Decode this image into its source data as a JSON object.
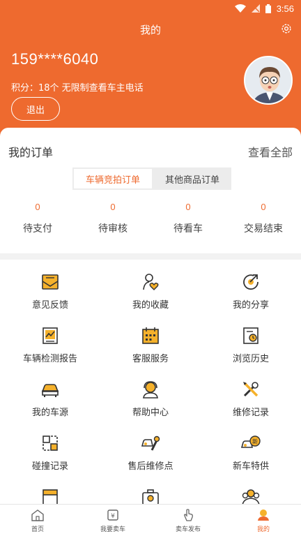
{
  "status": {
    "time": "3:56"
  },
  "header": {
    "title": "我的",
    "phone": "159****6040",
    "points": "积分：18个 无限制查看车主电话",
    "logout_label": "退出"
  },
  "orders": {
    "title": "我的订单",
    "view_all": "查看全部",
    "tabs": [
      {
        "label": "车辆竞拍订单",
        "active": true
      },
      {
        "label": "其他商品订单",
        "active": false
      }
    ],
    "counts": [
      {
        "value": "0",
        "label": "待支付"
      },
      {
        "value": "0",
        "label": "待审核"
      },
      {
        "value": "0",
        "label": "待看车"
      },
      {
        "value": "0",
        "label": "交易结束"
      }
    ]
  },
  "menu": [
    {
      "label": "意见反馈",
      "icon": "feedback-icon"
    },
    {
      "label": "我的收藏",
      "icon": "favorite-icon"
    },
    {
      "label": "我的分享",
      "icon": "share-icon"
    },
    {
      "label": "车辆检测报告",
      "icon": "report-icon"
    },
    {
      "label": "客服服务",
      "icon": "calendar-icon"
    },
    {
      "label": "浏览历史",
      "icon": "history-icon"
    },
    {
      "label": "我的车源",
      "icon": "car-icon"
    },
    {
      "label": "帮助中心",
      "icon": "headset-icon"
    },
    {
      "label": "维修记录",
      "icon": "tools-icon"
    },
    {
      "label": "碰撞记录",
      "icon": "collision-icon"
    },
    {
      "label": "售后维修点",
      "icon": "repair-car-icon"
    },
    {
      "label": "新车特供",
      "icon": "new-car-icon"
    },
    {
      "label": "",
      "icon": "shop-icon"
    },
    {
      "label": "",
      "icon": "camera-icon"
    },
    {
      "label": "",
      "icon": "group-icon"
    }
  ],
  "tabbar": [
    {
      "label": "首页",
      "icon": "home-icon"
    },
    {
      "label": "我要卖车",
      "icon": "sell-car-icon"
    },
    {
      "label": "卖车发布",
      "icon": "publish-icon"
    },
    {
      "label": "我的",
      "icon": "profile-icon",
      "active": true
    }
  ],
  "colors": {
    "accent": "#ee6a2f",
    "icon_fill": "#f5b12b"
  }
}
